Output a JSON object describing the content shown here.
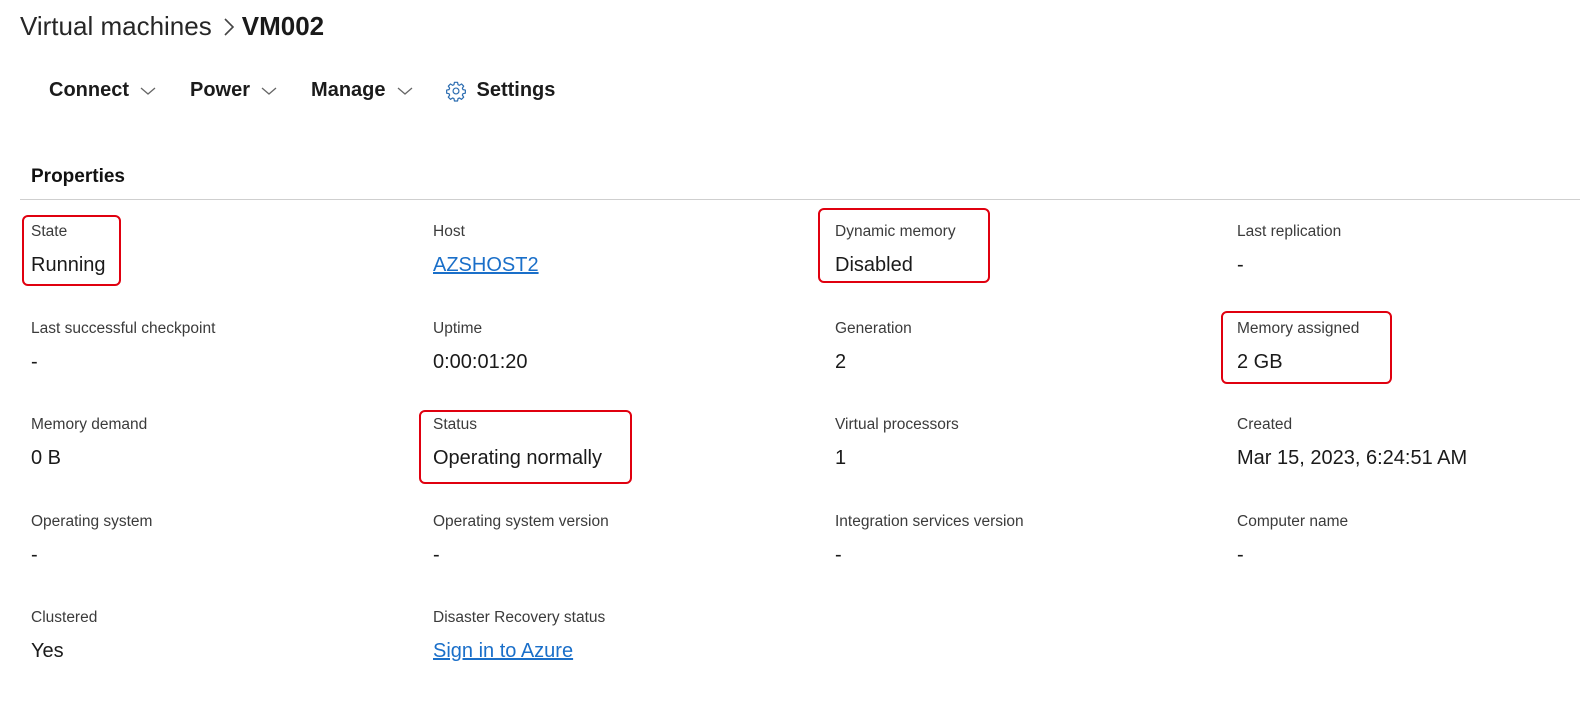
{
  "breadcrumb": {
    "parent": "Virtual machines",
    "current": "VM002"
  },
  "toolbar": {
    "connect": "Connect",
    "power": "Power",
    "manage": "Manage",
    "settings": "Settings"
  },
  "properties": {
    "title": "Properties",
    "state": {
      "label": "State",
      "value": "Running"
    },
    "host": {
      "label": "Host",
      "value": "AZSHOST2"
    },
    "dynamic_memory": {
      "label": "Dynamic memory",
      "value": "Disabled"
    },
    "last_replication": {
      "label": "Last replication",
      "value": "-"
    },
    "last_checkpoint": {
      "label": "Last successful checkpoint",
      "value": "-"
    },
    "uptime": {
      "label": "Uptime",
      "value": "0:00:01:20"
    },
    "generation": {
      "label": "Generation",
      "value": "2"
    },
    "memory_assigned": {
      "label": "Memory assigned",
      "value": "2 GB"
    },
    "memory_demand": {
      "label": "Memory demand",
      "value": "0 B"
    },
    "status": {
      "label": "Status",
      "value": "Operating normally"
    },
    "virtual_processors": {
      "label": "Virtual processors",
      "value": "1"
    },
    "created": {
      "label": "Created",
      "value": "Mar 15, 2023, 6:24:51 AM"
    },
    "os": {
      "label": "Operating system",
      "value": "-"
    },
    "os_version": {
      "label": "Operating system version",
      "value": "-"
    },
    "integration_services": {
      "label": "Integration services version",
      "value": "-"
    },
    "computer_name": {
      "label": "Computer name",
      "value": "-"
    },
    "clustered": {
      "label": "Clustered",
      "value": "Yes"
    },
    "dr_status": {
      "label": "Disaster Recovery status",
      "value": "Sign in to Azure"
    }
  },
  "colors": {
    "highlight": "#e0000f",
    "link": "#1a6fc9"
  }
}
